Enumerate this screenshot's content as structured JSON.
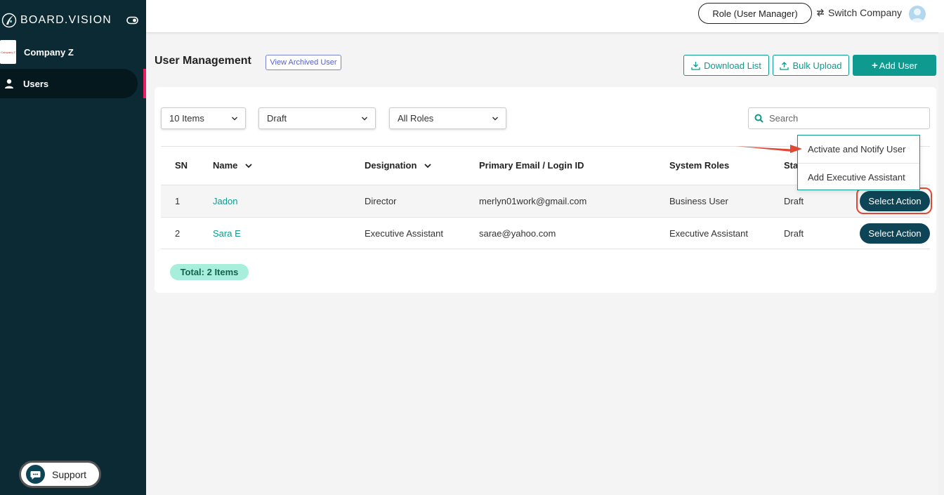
{
  "brand": {
    "name": "BOARD.VISION"
  },
  "sidebar": {
    "company_logo_text": "Company Z",
    "company_name": "Company Z",
    "nav": [
      {
        "label": "Users",
        "active": true
      }
    ],
    "support_label": "Support"
  },
  "header": {
    "role_label": "Role (User Manager)",
    "switch_company_label": "Switch Company"
  },
  "page": {
    "title": "User Management",
    "view_archived_label": "View Archived User",
    "download_label": "Download List",
    "bulk_upload_label": "Bulk Upload",
    "add_user_label": "Add User"
  },
  "filters": {
    "items_per_page": "10 Items",
    "status": "Draft",
    "roles": "All Roles",
    "search_placeholder": "Search"
  },
  "table": {
    "columns": [
      "SN",
      "Name",
      "Designation",
      "Primary Email / Login ID",
      "System Roles",
      "Status"
    ],
    "status_visible": "Sta",
    "rows": [
      {
        "sn": "1",
        "name": "Jadon",
        "designation": "Director",
        "email": "merlyn01work@gmail.com",
        "role": "Business User",
        "status": "Draft",
        "action": "Select Action"
      },
      {
        "sn": "2",
        "name": "Sara E",
        "designation": "Executive Assistant",
        "email": "sarae@yahoo.com",
        "role": "Executive Assistant",
        "status": "Draft",
        "action": "Select Action"
      }
    ]
  },
  "action_menu": {
    "items": [
      "Activate and Notify User",
      "Add Executive Assistant"
    ]
  },
  "footer": {
    "total": "Total: 2 Items"
  },
  "colors": {
    "sidebar": "#0b2a33",
    "accent": "#0f9a8f",
    "action_button": "#0e4556",
    "highlight": "#e04836",
    "nav_marker": "#e91e63",
    "total_badge": "#a7eedd"
  },
  "icons": [
    "board-vision-logo-icon",
    "toggle-icon",
    "user-icon",
    "chat-icon",
    "switch-icon",
    "avatar-icon",
    "download-icon",
    "upload-icon",
    "plus-icon",
    "chevron-down-icon",
    "search-icon",
    "arrow-icon"
  ]
}
